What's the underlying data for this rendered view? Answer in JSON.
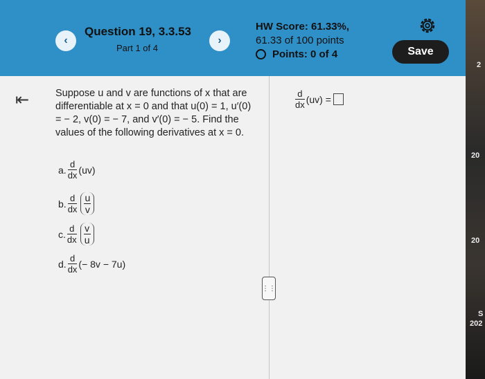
{
  "header": {
    "prev_glyph": "‹",
    "next_glyph": "›",
    "question_title": "Question 19, 3.3.53",
    "part_label": "Part 1 of 4",
    "hw_score": "HW Score: 61.33%,",
    "points_total": "61.33 of 100 points",
    "points_current": "Points: 0 of 4",
    "save_label": "Save"
  },
  "nav": {
    "back_glyph": "⇤"
  },
  "problem": {
    "statement": "Suppose u and v are functions of x that are differentiable at x = 0 and that u(0) = 1, u′(0) = − 2, v(0) = − 7, and v′(0) = − 5. Find the values of the following derivatives at x = 0.",
    "parts": [
      {
        "letter": "a.",
        "d_num": "d",
        "d_den": "dx",
        "expr": "(uv)"
      },
      {
        "letter": "b.",
        "d_num": "d",
        "d_den": "dx",
        "frac_num": "u",
        "frac_den": "v"
      },
      {
        "letter": "c.",
        "d_num": "d",
        "d_den": "dx",
        "frac_num": "v",
        "frac_den": "u"
      },
      {
        "letter": "d.",
        "d_num": "d",
        "d_den": "dx",
        "expr": "(− 8v − 7u)"
      }
    ]
  },
  "answer": {
    "d_num": "d",
    "d_den": "dx",
    "expr": "(uv) ="
  },
  "handle_glyph": "⋮⋮",
  "edge": {
    "labels": [
      "2",
      "20",
      "20",
      "S",
      "202"
    ]
  }
}
